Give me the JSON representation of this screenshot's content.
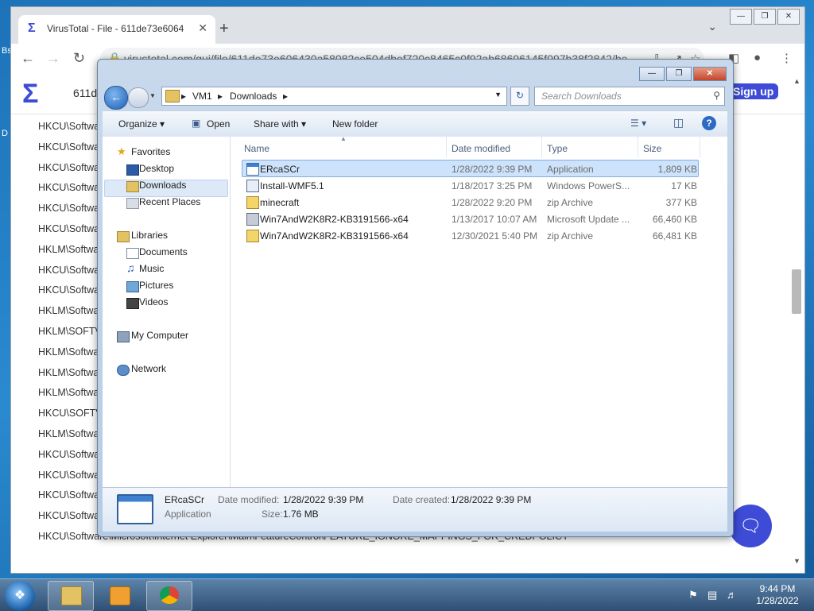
{
  "desktop": {
    "label_a": "Bs",
    "label_b": "D"
  },
  "browser": {
    "tab_title": "VirusTotal - File - 611de73e6064",
    "url": "virustotal.com/gui/file/611de73e606430a58082ce504dbef720c8465c0f92ab68696145f097b38f2842/be",
    "page_hash_snippet": "611de",
    "signup_label": "Sign up",
    "registry_entries": [
      "HKCU\\Softwa",
      "HKCU\\Softwa",
      "HKCU\\Softwa",
      "HKCU\\Softwa",
      "HKCU\\Softwa",
      "HKCU\\Softwa",
      "HKLM\\Softwa",
      "HKCU\\Softwa",
      "HKCU\\Softwa",
      "HKLM\\Softwa",
      "HKLM\\SOFTV",
      "HKLM\\Softwa",
      "HKLM\\Softwa",
      "HKLM\\Softwa",
      "HKCU\\SOFTV",
      "HKLM\\Softwa",
      "HKCU\\Softwa",
      "HKCU\\Softwa",
      "HKCU\\Softwa",
      "HKCU\\Softwa",
      "HKCU\\Software\\Microsoft\\Internet Explorer\\Main\\FeatureControl\\FEATURE_IGNORE_MAPPINGS_FOR_CREDPOLICY"
    ]
  },
  "explorer": {
    "breadcrumb": [
      "VM1",
      "Downloads"
    ],
    "search_placeholder": "Search Downloads",
    "commands": {
      "organize": "Organize",
      "open": "Open",
      "share_with": "Share with",
      "new_folder": "New folder"
    },
    "nav": {
      "favorites": "Favorites",
      "desktop": "Desktop",
      "downloads": "Downloads",
      "recent_places": "Recent Places",
      "libraries": "Libraries",
      "documents": "Documents",
      "music": "Music",
      "pictures": "Pictures",
      "videos": "Videos",
      "my_computer": "My Computer",
      "network": "Network"
    },
    "columns": {
      "name": "Name",
      "date_modified": "Date modified",
      "type": "Type",
      "size": "Size"
    },
    "files": [
      {
        "name": "ERcaSCr",
        "date": "1/28/2022 9:39 PM",
        "type": "Application",
        "size": "1,809 KB"
      },
      {
        "name": "Install-WMF5.1",
        "date": "1/18/2017 3:25 PM",
        "type": "Windows PowerS...",
        "size": "17 KB"
      },
      {
        "name": "minecraft",
        "date": "1/28/2022 9:20 PM",
        "type": "zip Archive",
        "size": "377 KB"
      },
      {
        "name": "Win7AndW2K8R2-KB3191566-x64",
        "date": "1/13/2017 10:07 AM",
        "type": "Microsoft Update ...",
        "size": "66,460 KB"
      },
      {
        "name": "Win7AndW2K8R2-KB3191566-x64",
        "date": "12/30/2021 5:40 PM",
        "type": "zip Archive",
        "size": "66,481 KB"
      }
    ],
    "details": {
      "name": "ERcaSCr",
      "type": "Application",
      "date_modified_label": "Date modified:",
      "date_modified": "1/28/2022 9:39 PM",
      "date_created_label": "Date created:",
      "date_created": "1/28/2022 9:39 PM",
      "size_label": "Size:",
      "size": "1.76 MB"
    }
  },
  "taskbar": {
    "time": "9:44 PM",
    "date": "1/28/2022"
  }
}
